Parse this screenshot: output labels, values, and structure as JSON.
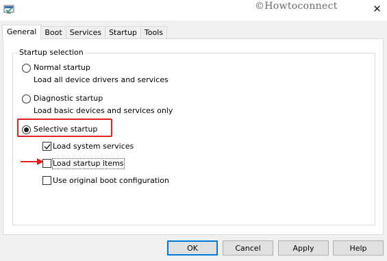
{
  "watermark": "©Howtoconnect",
  "close_glyph": "✕",
  "tabs": [
    "General",
    "Boot",
    "Services",
    "Startup",
    "Tools"
  ],
  "group": {
    "title": "Startup selection",
    "options": [
      {
        "label": "Normal startup",
        "desc": "Load all device drivers and services",
        "checked": false
      },
      {
        "label": "Diagnostic startup",
        "desc": "Load basic devices and services only",
        "checked": false
      },
      {
        "label": "Selective startup",
        "checked": true
      }
    ],
    "checkboxes": [
      {
        "label": "Load system services",
        "checked": true
      },
      {
        "label": "Load startup items",
        "checked": false
      },
      {
        "label": "Use original boot configuration",
        "checked": false
      }
    ]
  },
  "buttons": {
    "ok": "OK",
    "cancel": "Cancel",
    "apply": "Apply",
    "help": "Help"
  },
  "colors": {
    "annotation": "#e02020",
    "focus_blue": "#0078d7"
  },
  "icons": [
    "msconfig-app-icon",
    "close-icon",
    "red-arrow-icon",
    "checkmark-icon"
  ]
}
